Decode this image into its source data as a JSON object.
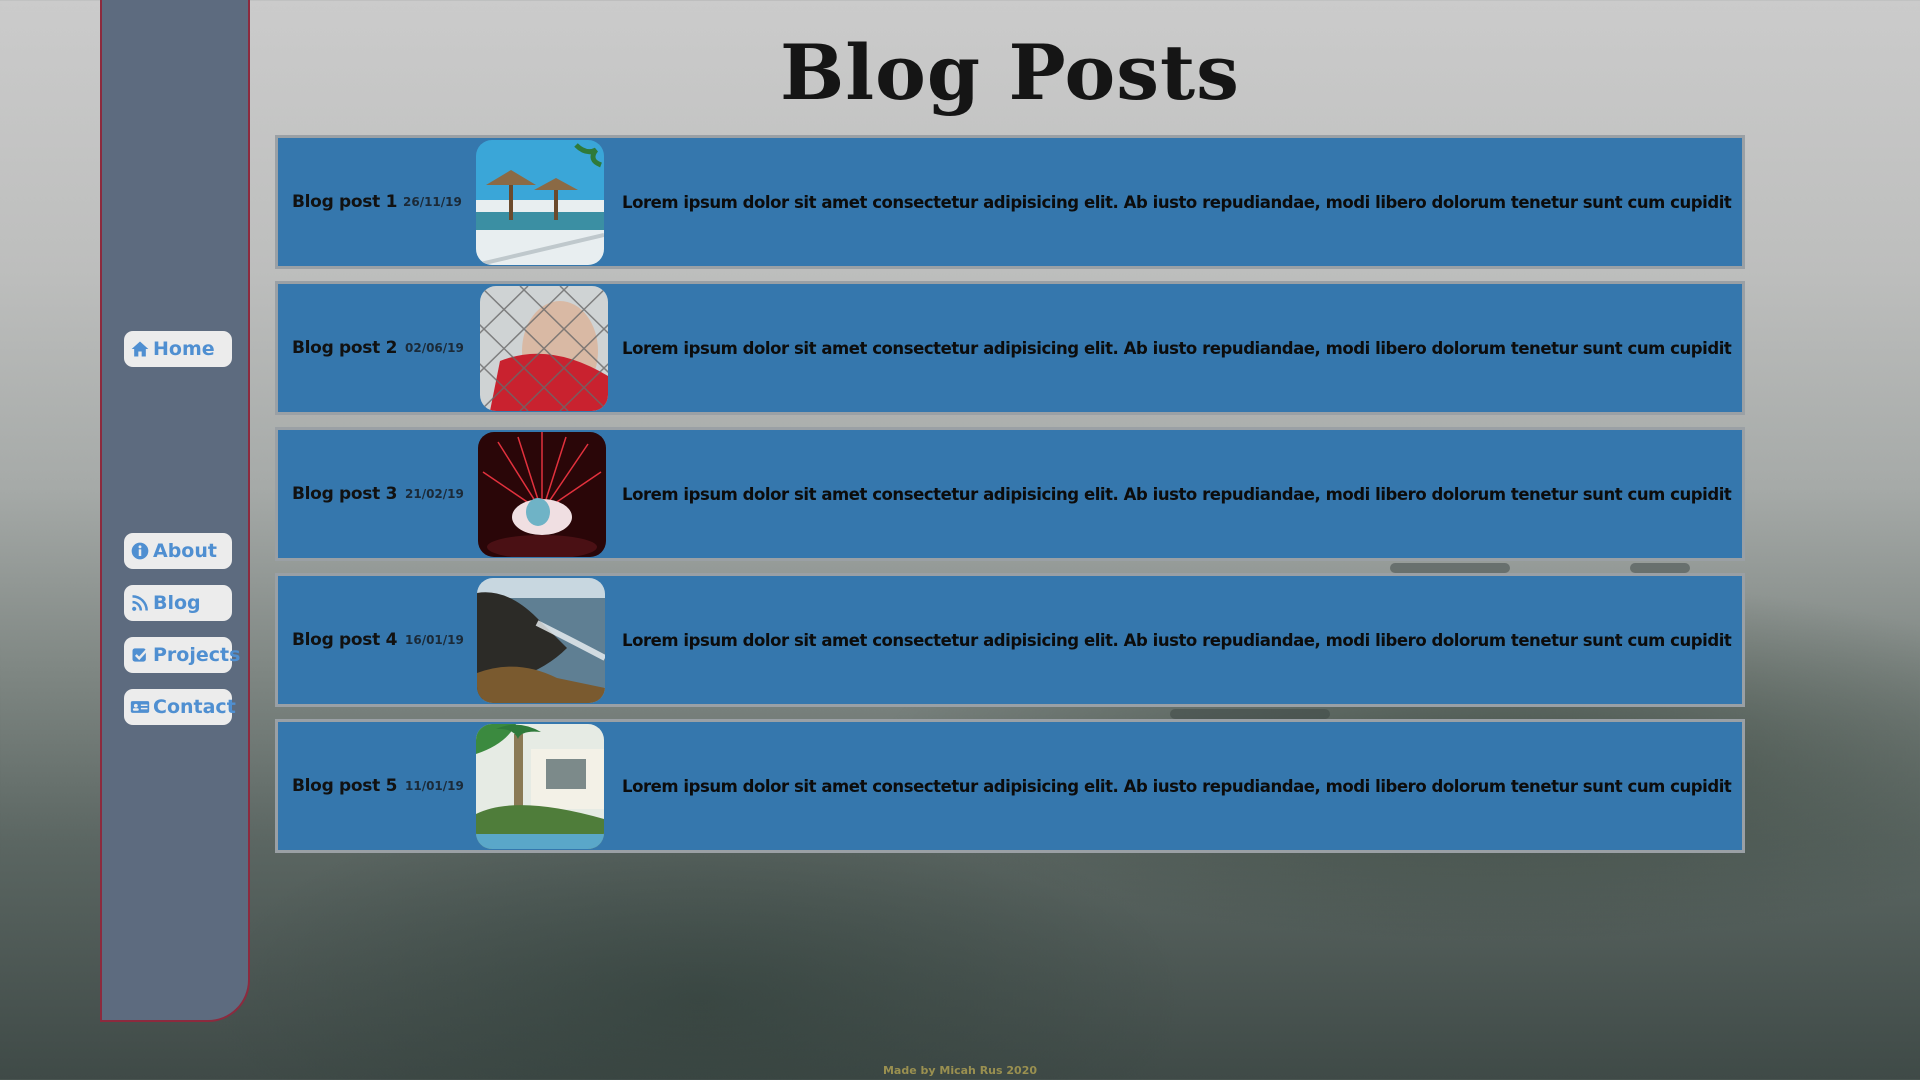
{
  "page": {
    "title": "Blog Posts"
  },
  "nav": {
    "items": [
      {
        "label": "Home",
        "icon": "home-icon"
      },
      {
        "label": "About",
        "icon": "info-icon"
      },
      {
        "label": "Blog",
        "icon": "rss-icon"
      },
      {
        "label": "Projects",
        "icon": "check-icon"
      },
      {
        "label": "Contact",
        "icon": "contact-card-icon"
      }
    ]
  },
  "posts": [
    {
      "title": "Blog post 1",
      "date": "26/11/19",
      "excerpt": "Lorem ipsum dolor sit amet consectetur adipisicing elit. Ab iusto repudiandae, modi libero dolorum tenetur sunt cum cupiditate quaerat nostrum?",
      "image": "beach-umbrellas-image"
    },
    {
      "title": "Blog post 2",
      "date": "02/06/19",
      "excerpt": "Lorem ipsum dolor sit amet consectetur adipisicing elit. Ab iusto repudiandae, modi libero dolorum tenetur sunt cum cupiditate quaerat nostrum?",
      "image": "person-behind-fence-image"
    },
    {
      "title": "Blog post 3",
      "date": "21/02/19",
      "excerpt": "Lorem ipsum dolor sit amet consectetur adipisicing elit. Ab iusto repudiandae, modi libero dolorum tenetur sunt cum cupiditate quaerat nostrum?",
      "image": "red-sparks-image"
    },
    {
      "title": "Blog post 4",
      "date": "16/01/19",
      "excerpt": "Lorem ipsum dolor sit amet consectetur adipisicing elit. Ab iusto repudiandae, modi libero dolorum tenetur sunt cum cupiditate quaerat nostrum?",
      "image": "coastal-cliff-image"
    },
    {
      "title": "Blog post 5",
      "date": "11/01/19",
      "excerpt": "Lorem ipsum dolor sit amet consectetur adipisicing elit. Ab iusto repudiandae, modi libero dolorum tenetur sunt cum cupiditate quaerat nostrum?",
      "image": "palm-resort-image"
    }
  ],
  "footer": {
    "text": "Made by Micah Rus 2020"
  },
  "colors": {
    "sidebar": "#5d6b7f",
    "sidebar_border": "#8c2a3e",
    "post_bg": "#3577ad",
    "nav_text": "#4f8fd1"
  }
}
